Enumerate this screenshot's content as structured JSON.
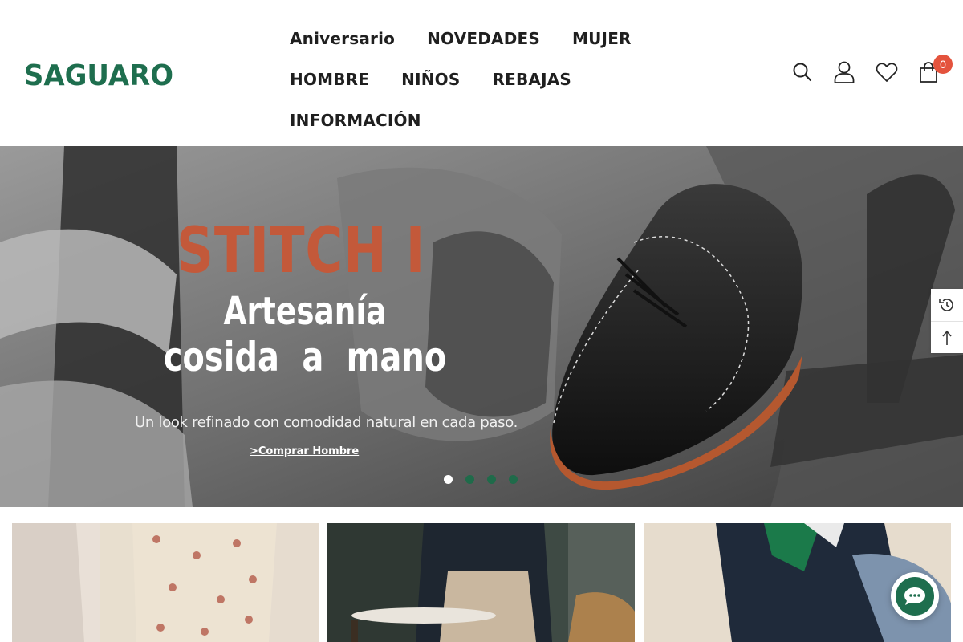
{
  "brand": {
    "name": "SAGUARO",
    "color": "#1e6e4e"
  },
  "nav": {
    "items": [
      {
        "label": "Aniversario"
      },
      {
        "label": "NOVEDADES"
      },
      {
        "label": "MUJER"
      },
      {
        "label": "HOMBRE"
      },
      {
        "label": "NIÑOS"
      },
      {
        "label": "REBAJAS"
      },
      {
        "label": "INFORMACIÓN"
      }
    ]
  },
  "header_icons": {
    "search": "search-icon",
    "account": "user-icon",
    "wishlist": "heart-icon",
    "cart": "bag-icon",
    "cart_count": "0"
  },
  "hero": {
    "title": "STITCH I",
    "subtitle_line1": "Artesanía",
    "subtitle_line2": "cosida a mano",
    "tagline": "Un look refinado con comodidad natural en cada paso.",
    "cta": ">Comprar Hombre",
    "slides": 4,
    "active_slide": 1,
    "title_color": "#c3593a"
  },
  "side_tools": {
    "recent": "history-icon",
    "top": "arrow-up-icon"
  },
  "chat": {
    "icon": "chat-bubble-icon"
  }
}
